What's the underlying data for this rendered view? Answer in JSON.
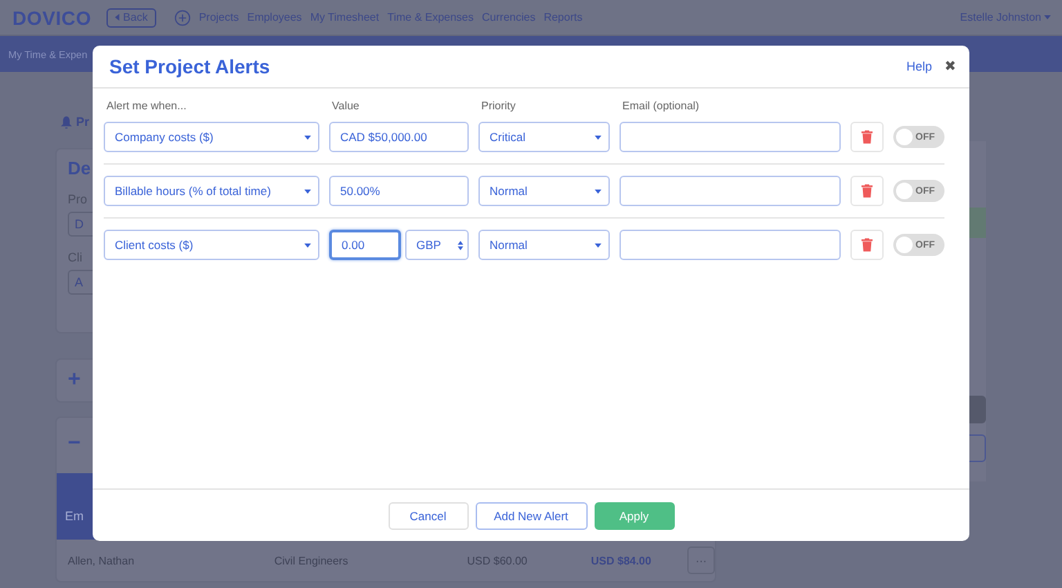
{
  "nav": {
    "logo": "DOVICO",
    "back": "Back",
    "links": [
      "Projects",
      "Employees",
      "My Timesheet",
      "Time & Expenses",
      "Currencies",
      "Reports"
    ],
    "user": "Estelle Johnston"
  },
  "subbar": {
    "title": "My Time & Expen"
  },
  "background": {
    "section_title": "Pr",
    "card_heading": "De",
    "label_1": "Pro",
    "field_1": "D",
    "label_2": "Cli",
    "field_2": "A",
    "expand_toggle": "+",
    "collapse_toggle": "−",
    "table_header": "Em",
    "row": {
      "name": "Allen, Nathan",
      "group": "Civil Engineers",
      "cost": "USD $60.00",
      "rate": "USD $84.00",
      "more": "···"
    }
  },
  "dialog": {
    "title": "Set Project Alerts",
    "help": "Help",
    "close": "✖",
    "columns": [
      "Alert me when...",
      "Value",
      "Priority",
      "Email (optional)"
    ],
    "rows": [
      {
        "condition": "Company costs ($)",
        "kind": "plain",
        "value": "CAD $50,000.00",
        "focused": false,
        "priority": "Critical",
        "on": false,
        "toggle_label": "OFF"
      },
      {
        "condition": "Billable hours (% of total time)",
        "kind": "plain",
        "value": "50.00%",
        "focused": false,
        "priority": "Normal",
        "on": false,
        "toggle_label": "OFF"
      },
      {
        "condition": "Client costs ($)",
        "kind": "currency",
        "value": "0.00",
        "currency": "GBP",
        "focused": true,
        "priority": "Normal",
        "on": false,
        "toggle_label": "OFF"
      }
    ],
    "buttons": {
      "cancel": "Cancel",
      "add": "Add New Alert",
      "apply": "Apply"
    }
  }
}
